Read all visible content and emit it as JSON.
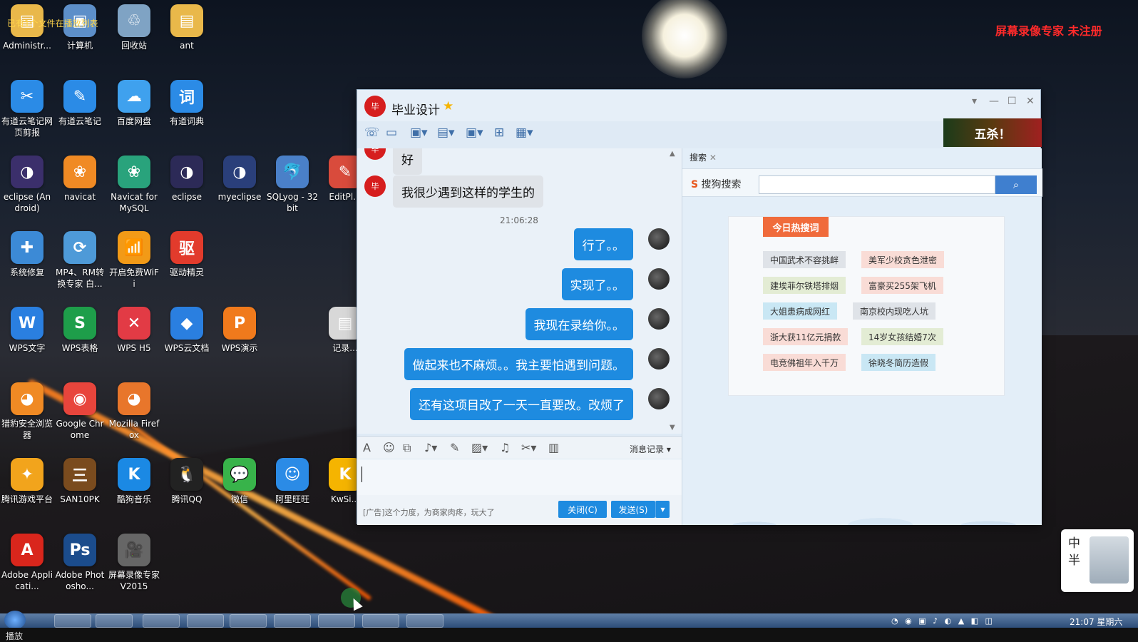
{
  "top_note": "已有1个文件在播放列表",
  "watermark": "屏幕录像专家 未注册",
  "desktop_icons": [
    {
      "label": "Administr...",
      "icon": "folder-icon",
      "color": "#e9b84a",
      "glyph": "▤"
    },
    {
      "label": "计算机",
      "icon": "computer-icon",
      "color": "#5d8fc9",
      "glyph": "▣"
    },
    {
      "label": "回收站",
      "icon": "recycle-bin-icon",
      "color": "#7fa3c4",
      "glyph": "♲"
    },
    {
      "label": "ant",
      "icon": "folder-icon",
      "color": "#e9b84a",
      "glyph": "▤"
    },
    {
      "label": "有道云笔记网页剪报",
      "icon": "youdao-clip-icon",
      "color": "#2b8be6",
      "glyph": "✂"
    },
    {
      "label": "有道云笔记",
      "icon": "youdao-note-icon",
      "color": "#2b8be6",
      "glyph": "✎"
    },
    {
      "label": "百度网盘",
      "icon": "baidu-netdisk-icon",
      "color": "#3fa1ee",
      "glyph": "☁"
    },
    {
      "label": "有道词典",
      "icon": "youdao-dict-icon",
      "color": "#2b8be6",
      "glyph": "词"
    },
    {
      "label": "eclipse (Android)",
      "icon": "eclipse-icon",
      "color": "#3b2f6b",
      "glyph": "◑"
    },
    {
      "label": "navicat",
      "icon": "navicat-icon",
      "color": "#f08a24",
      "glyph": "❀"
    },
    {
      "label": "Navicat for MySQL",
      "icon": "navicat-mysql-icon",
      "color": "#29a37c",
      "glyph": "❀"
    },
    {
      "label": "eclipse",
      "icon": "eclipse-icon",
      "color": "#2c2a57",
      "glyph": "◑"
    },
    {
      "label": "myeclipse",
      "icon": "myeclipse-icon",
      "color": "#2a3f7a",
      "glyph": "◑"
    },
    {
      "label": "SQLyog - 32 bit",
      "icon": "sqlyog-icon",
      "color": "#4a80c8",
      "glyph": "🐬"
    },
    {
      "label": "EditPl...",
      "icon": "editplus-icon",
      "color": "#d94b3c",
      "glyph": "✎"
    },
    {
      "label": "系统修复",
      "icon": "system-repair-icon",
      "color": "#3c8ad6",
      "glyph": "✚"
    },
    {
      "label": "MP4、RM转换专家 白...",
      "icon": "converter-icon",
      "color": "#4e9ad8",
      "glyph": "⟳"
    },
    {
      "label": "开启免费WiFi",
      "icon": "wifi-icon",
      "color": "#f29a17",
      "glyph": "📶"
    },
    {
      "label": "驱动精灵",
      "icon": "driver-icon",
      "color": "#e23b2c",
      "glyph": "驱"
    },
    {
      "label": "WPS文字",
      "icon": "wps-writer-icon",
      "color": "#2a7fe0",
      "glyph": "W"
    },
    {
      "label": "WPS表格",
      "icon": "wps-sheet-icon",
      "color": "#1e9e4a",
      "glyph": "S"
    },
    {
      "label": "WPS H5",
      "icon": "wps-h5-icon",
      "color": "#e23b45",
      "glyph": "✕"
    },
    {
      "label": "WPS云文档",
      "icon": "wps-cloud-icon",
      "color": "#2a7fe0",
      "glyph": "◆"
    },
    {
      "label": "WPS演示",
      "icon": "wps-present-icon",
      "color": "#f07a1c",
      "glyph": "P"
    },
    {
      "label": "记录...",
      "icon": "notes-icon",
      "color": "#d8d8d8",
      "glyph": "▤"
    },
    {
      "label": "猎豹安全浏览器",
      "icon": "liebao-icon",
      "color": "#f08a24",
      "glyph": "◕"
    },
    {
      "label": "Google Chrome",
      "icon": "chrome-icon",
      "color": "#e8453c",
      "glyph": "◉"
    },
    {
      "label": "Mozilla Firefox",
      "icon": "firefox-icon",
      "color": "#e8762b",
      "glyph": "◕"
    },
    {
      "label": "腾讯游戏平台",
      "icon": "tencent-games-icon",
      "color": "#f2a41c",
      "glyph": "✦"
    },
    {
      "label": "SAN10PK",
      "icon": "san10pk-icon",
      "color": "#7a4b1e",
      "glyph": "三"
    },
    {
      "label": "酷狗音乐",
      "icon": "kugou-icon",
      "color": "#1b89e4",
      "glyph": "K"
    },
    {
      "label": "腾讯QQ",
      "icon": "qq-icon",
      "color": "#222",
      "glyph": "🐧"
    },
    {
      "label": "微信",
      "icon": "wechat-icon",
      "color": "#38b34a",
      "glyph": "💬"
    },
    {
      "label": "阿里旺旺",
      "icon": "aliwangwang-icon",
      "color": "#2b8be6",
      "glyph": "☺"
    },
    {
      "label": "KwSi...",
      "icon": "kw-icon",
      "color": "#f5b400",
      "glyph": "K"
    },
    {
      "label": "Adobe Applicati...",
      "icon": "adobe-icon",
      "color": "#d9261c",
      "glyph": "A"
    },
    {
      "label": "Adobe Photosho...",
      "icon": "photoshop-icon",
      "color": "#1b4c8c",
      "glyph": "Ps"
    },
    {
      "label": "屏幕录像专家 V2015",
      "icon": "screen-recorder-icon",
      "color": "#666",
      "glyph": "🎥"
    }
  ],
  "chat": {
    "title": "毕业设计",
    "ad_banner": "五杀！",
    "messages": [
      {
        "dir": "in",
        "text": "好"
      },
      {
        "dir": "in",
        "text": "我很少遇到这样的学生的"
      },
      {
        "dir": "time",
        "text": "21:06:28"
      },
      {
        "dir": "out",
        "text": "行了。。"
      },
      {
        "dir": "out",
        "text": "实现了。。"
      },
      {
        "dir": "out",
        "text": "我现在录给你。。"
      },
      {
        "dir": "out",
        "text": "做起来也不麻烦。。我主要怕遇到问题。"
      },
      {
        "dir": "out",
        "text": "还有这项目改了一天一直要改。改烦了"
      }
    ],
    "message_record": "消息记录",
    "ad_text": "[广告]这个力度，为商家肉疼，玩大了",
    "close_button": "关闭(C)",
    "send_button": "发送(S)"
  },
  "search_panel": {
    "tab_label": "搜索",
    "sogou_label": "搜狗搜索",
    "search_value": "",
    "hot_title": "今日热搜词",
    "hot_items": [
      {
        "text": "中国武术不容挑衅",
        "color": "#dfe3e8"
      },
      {
        "text": "美军少校贪色泄密",
        "color": "#f9dcd6"
      },
      {
        "text": "建埃菲尔铁塔排烟",
        "color": "#e3ecd4"
      },
      {
        "text": "富豪买255架飞机",
        "color": "#f9dcd6"
      },
      {
        "text": "大姐患病成网红",
        "color": "#c9e7f4"
      },
      {
        "text": "南京校内现吃人坑",
        "color": "#dfe3e8"
      },
      {
        "text": "浙大获11亿元捐款",
        "color": "#f9dcd6"
      },
      {
        "text": "14岁女孩结婚7次",
        "color": "#e3ecd4"
      },
      {
        "text": "电竞佛祖年入千万",
        "color": "#f9dcd6"
      },
      {
        "text": "徐晓冬简历造假",
        "color": "#c9e7f4"
      }
    ]
  },
  "seal_text": "中半",
  "clock": "21:07 星期六",
  "status_label": "播放"
}
